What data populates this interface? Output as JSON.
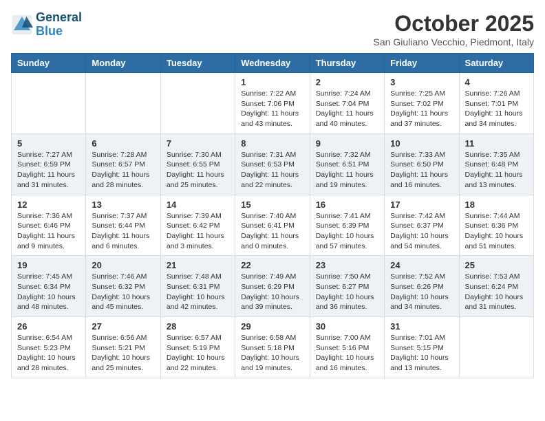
{
  "header": {
    "logo_line1": "General",
    "logo_line2": "Blue",
    "month_title": "October 2025",
    "location": "San Giuliano Vecchio, Piedmont, Italy"
  },
  "weekdays": [
    "Sunday",
    "Monday",
    "Tuesday",
    "Wednesday",
    "Thursday",
    "Friday",
    "Saturday"
  ],
  "weeks": [
    [
      {
        "day": "",
        "info": ""
      },
      {
        "day": "",
        "info": ""
      },
      {
        "day": "",
        "info": ""
      },
      {
        "day": "1",
        "info": "Sunrise: 7:22 AM\nSunset: 7:06 PM\nDaylight: 11 hours and 43 minutes."
      },
      {
        "day": "2",
        "info": "Sunrise: 7:24 AM\nSunset: 7:04 PM\nDaylight: 11 hours and 40 minutes."
      },
      {
        "day": "3",
        "info": "Sunrise: 7:25 AM\nSunset: 7:02 PM\nDaylight: 11 hours and 37 minutes."
      },
      {
        "day": "4",
        "info": "Sunrise: 7:26 AM\nSunset: 7:01 PM\nDaylight: 11 hours and 34 minutes."
      }
    ],
    [
      {
        "day": "5",
        "info": "Sunrise: 7:27 AM\nSunset: 6:59 PM\nDaylight: 11 hours and 31 minutes."
      },
      {
        "day": "6",
        "info": "Sunrise: 7:28 AM\nSunset: 6:57 PM\nDaylight: 11 hours and 28 minutes."
      },
      {
        "day": "7",
        "info": "Sunrise: 7:30 AM\nSunset: 6:55 PM\nDaylight: 11 hours and 25 minutes."
      },
      {
        "day": "8",
        "info": "Sunrise: 7:31 AM\nSunset: 6:53 PM\nDaylight: 11 hours and 22 minutes."
      },
      {
        "day": "9",
        "info": "Sunrise: 7:32 AM\nSunset: 6:51 PM\nDaylight: 11 hours and 19 minutes."
      },
      {
        "day": "10",
        "info": "Sunrise: 7:33 AM\nSunset: 6:50 PM\nDaylight: 11 hours and 16 minutes."
      },
      {
        "day": "11",
        "info": "Sunrise: 7:35 AM\nSunset: 6:48 PM\nDaylight: 11 hours and 13 minutes."
      }
    ],
    [
      {
        "day": "12",
        "info": "Sunrise: 7:36 AM\nSunset: 6:46 PM\nDaylight: 11 hours and 9 minutes."
      },
      {
        "day": "13",
        "info": "Sunrise: 7:37 AM\nSunset: 6:44 PM\nDaylight: 11 hours and 6 minutes."
      },
      {
        "day": "14",
        "info": "Sunrise: 7:39 AM\nSunset: 6:42 PM\nDaylight: 11 hours and 3 minutes."
      },
      {
        "day": "15",
        "info": "Sunrise: 7:40 AM\nSunset: 6:41 PM\nDaylight: 11 hours and 0 minutes."
      },
      {
        "day": "16",
        "info": "Sunrise: 7:41 AM\nSunset: 6:39 PM\nDaylight: 10 hours and 57 minutes."
      },
      {
        "day": "17",
        "info": "Sunrise: 7:42 AM\nSunset: 6:37 PM\nDaylight: 10 hours and 54 minutes."
      },
      {
        "day": "18",
        "info": "Sunrise: 7:44 AM\nSunset: 6:36 PM\nDaylight: 10 hours and 51 minutes."
      }
    ],
    [
      {
        "day": "19",
        "info": "Sunrise: 7:45 AM\nSunset: 6:34 PM\nDaylight: 10 hours and 48 minutes."
      },
      {
        "day": "20",
        "info": "Sunrise: 7:46 AM\nSunset: 6:32 PM\nDaylight: 10 hours and 45 minutes."
      },
      {
        "day": "21",
        "info": "Sunrise: 7:48 AM\nSunset: 6:31 PM\nDaylight: 10 hours and 42 minutes."
      },
      {
        "day": "22",
        "info": "Sunrise: 7:49 AM\nSunset: 6:29 PM\nDaylight: 10 hours and 39 minutes."
      },
      {
        "day": "23",
        "info": "Sunrise: 7:50 AM\nSunset: 6:27 PM\nDaylight: 10 hours and 36 minutes."
      },
      {
        "day": "24",
        "info": "Sunrise: 7:52 AM\nSunset: 6:26 PM\nDaylight: 10 hours and 34 minutes."
      },
      {
        "day": "25",
        "info": "Sunrise: 7:53 AM\nSunset: 6:24 PM\nDaylight: 10 hours and 31 minutes."
      }
    ],
    [
      {
        "day": "26",
        "info": "Sunrise: 6:54 AM\nSunset: 5:23 PM\nDaylight: 10 hours and 28 minutes."
      },
      {
        "day": "27",
        "info": "Sunrise: 6:56 AM\nSunset: 5:21 PM\nDaylight: 10 hours and 25 minutes."
      },
      {
        "day": "28",
        "info": "Sunrise: 6:57 AM\nSunset: 5:19 PM\nDaylight: 10 hours and 22 minutes."
      },
      {
        "day": "29",
        "info": "Sunrise: 6:58 AM\nSunset: 5:18 PM\nDaylight: 10 hours and 19 minutes."
      },
      {
        "day": "30",
        "info": "Sunrise: 7:00 AM\nSunset: 5:16 PM\nDaylight: 10 hours and 16 minutes."
      },
      {
        "day": "31",
        "info": "Sunrise: 7:01 AM\nSunset: 5:15 PM\nDaylight: 10 hours and 13 minutes."
      },
      {
        "day": "",
        "info": ""
      }
    ]
  ]
}
